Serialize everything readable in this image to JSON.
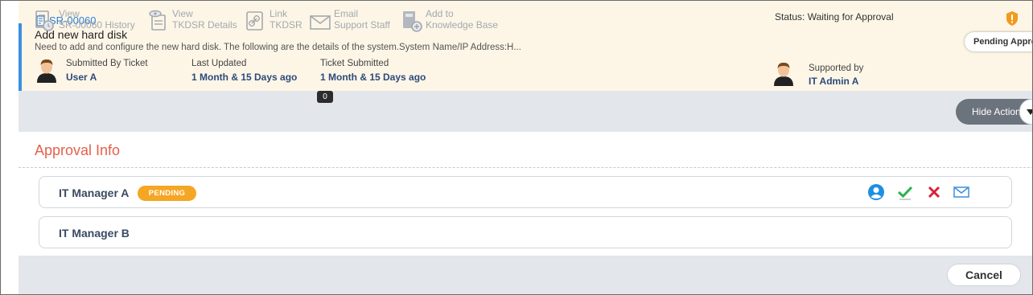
{
  "ticket": {
    "id": "SR-00060",
    "title": "Add new hard disk",
    "description": "Need to add and configure the new hard disk. The following are the details of the system.System Name/IP Address:H...",
    "submitted_by_label": "Submitted By Ticket",
    "submitted_by": "User A",
    "last_updated_label": "Last Updated",
    "last_updated": "1 Month & 15 Days ago",
    "ticket_submitted_label": "Ticket Submitted",
    "ticket_submitted": "1 Month & 15 Days ago",
    "status": "Status: Waiting for Approval",
    "pending_pill": "Pending Approval",
    "supported_by_label": "Supported by",
    "supported_by": "IT Admin A"
  },
  "toolbar": {
    "view_history_line1": "View",
    "view_history_line2": "SR-00060 History",
    "view_details_line1": "View",
    "view_details_line2": "TKDSR Details",
    "link_line1": "Link",
    "link_line2": "TKDSR",
    "email_line1": "Email",
    "email_line2": "Support Staff",
    "email_count": "0",
    "kb_line1": "Add to",
    "kb_line2": "Knowledge Base",
    "hide_actions": "Hide Actions"
  },
  "approval": {
    "title": "Approval Info",
    "approvers": [
      {
        "name": "IT Manager A",
        "status": "PENDING"
      },
      {
        "name": "IT Manager B"
      }
    ]
  },
  "footer": {
    "cancel_label": "Cancel"
  },
  "colors": {
    "header_bg": "#fdf6e7",
    "accent_blue": "#3b8fe0",
    "approval_title": "#e5604a",
    "pending_badge": "#f5a623",
    "approve_green": "#2bb24c",
    "reject_red": "#d6223b",
    "alert_orange": "#f29a1c"
  },
  "icons": {
    "ticket": "ticket-doc-icon",
    "alert": "alert-shield-icon",
    "history": "history-doc-icon",
    "details": "eye-doc-icon",
    "link": "link-icon",
    "email": "envelope-icon",
    "knowledge_base": "book-add-icon",
    "user": "user-circle-icon",
    "approve": "checkmark-icon",
    "reject": "x-icon",
    "mail": "mail-icon"
  }
}
